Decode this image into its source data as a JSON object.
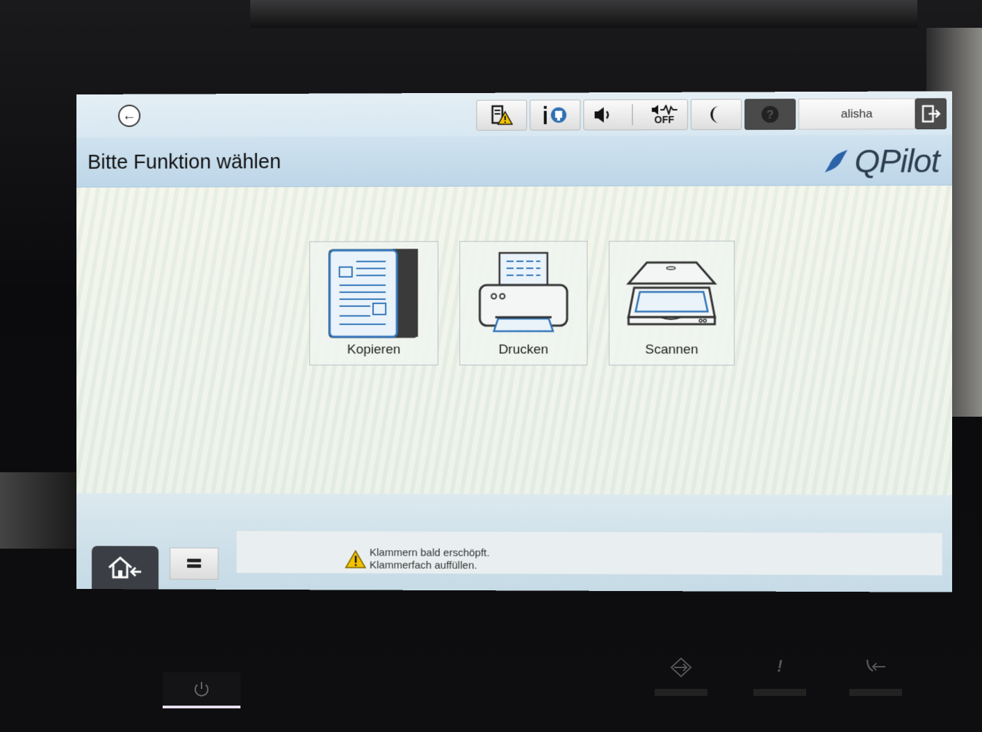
{
  "statusbar": {
    "back_icon": "arrow-left-icon",
    "tools": [
      {
        "name": "consumables-warning-icon"
      },
      {
        "name": "device-info-icon"
      },
      {
        "name": "volume-icon"
      },
      {
        "name": "sound-off-icon",
        "label": "OFF"
      },
      {
        "name": "sleep-moon-icon"
      },
      {
        "name": "help-icon"
      }
    ],
    "username": "alisha",
    "logout_icon": "logout-icon"
  },
  "header": {
    "title": "Bitte Funktion wählen",
    "brand": "QPilot",
    "brand_color": "#2c3e50"
  },
  "functions": [
    {
      "label": "Kopieren",
      "icon": "copy-icon"
    },
    {
      "label": "Drucken",
      "icon": "printer-icon"
    },
    {
      "label": "Scannen",
      "icon": "scanner-icon"
    }
  ],
  "footer": {
    "home_icon": "home-icon",
    "jobs_icon": "job-list-icon",
    "warning_line1": "Klammern bald erschöpft.",
    "warning_line2": "Klammerfach auffüllen.",
    "warning_color": "#f2c200"
  },
  "hardware": {
    "power_icon": "power-icon",
    "data_icon": "data-transfer-icon",
    "error_label": "!",
    "fax_icon": "fax-return-icon"
  }
}
